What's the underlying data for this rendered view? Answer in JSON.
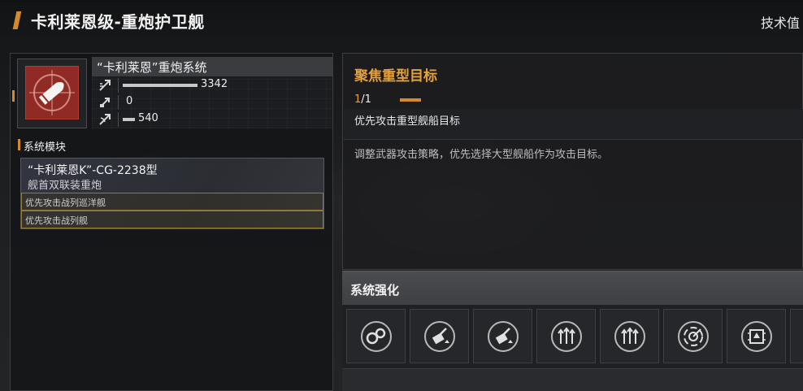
{
  "header": {
    "title": "卡利莱恩级-重炮护卫舰",
    "tech_link": "技术值"
  },
  "system": {
    "name": "“卡利莱恩”重炮系统",
    "icon": "shell-target-icon",
    "stats": [
      {
        "icon": "damage-icon",
        "value": "3342",
        "bar_fraction": 1.0
      },
      {
        "icon": "armor-pierce-icon",
        "value": "0",
        "bar_fraction": 0.0
      },
      {
        "icon": "range-icon",
        "value": "540",
        "bar_fraction": 0.16
      }
    ]
  },
  "modules": {
    "section_title": "系统模块",
    "card": {
      "name": "“卡利莱恩K”-CG-2238型",
      "subtitle": "舰首双联装重炮",
      "tags": [
        "优先攻击战列巡洋舰",
        "优先攻击战列舰"
      ]
    }
  },
  "detail": {
    "title": "聚焦重型目标",
    "level_current": "1",
    "level_total": "/1",
    "subhead": "优先攻击重型舰船目标",
    "description": "调整武器攻击策略，优先选择大型舰船作为攻击目标。"
  },
  "enhancement": {
    "title": "系统强化",
    "slots": [
      {
        "icon": "gear-cluster-icon"
      },
      {
        "icon": "turret-upgrade-icon"
      },
      {
        "icon": "turret-upgrade-icon"
      },
      {
        "icon": "triple-arrow-up-icon"
      },
      {
        "icon": "triple-arrow-up-icon"
      },
      {
        "icon": "radar-sweep-icon"
      },
      {
        "icon": "chip-icon"
      }
    ]
  },
  "colors": {
    "accent": "#d28a2a",
    "title_orange": "#e6a23a",
    "icon_red": "#8f2a24",
    "tag_border": "#8f7a3a"
  }
}
